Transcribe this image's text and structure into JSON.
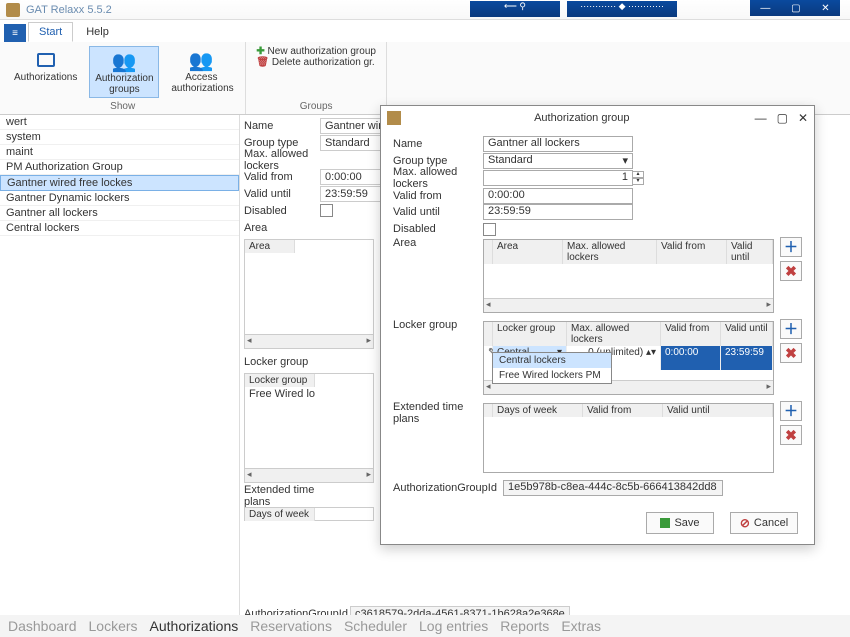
{
  "app": {
    "title": "GAT Relaxx 5.5.2",
    "tabs": {
      "start": "Start",
      "help": "Help"
    }
  },
  "ribbon": {
    "auth": "Authorizations",
    "auth_groups": "Authorization groups",
    "access_auth": "Access authorizations",
    "show": "Show",
    "new_group": "New authorization group",
    "delete_group": "Delete authorization gr.",
    "groups": "Groups"
  },
  "sidebar": {
    "items": [
      "wert",
      "system",
      "maint",
      "PM Authorization Group",
      "Gantner wired free lockes",
      "Gantner Dynamic lockers",
      "Gantner all lockers",
      "Central lockers"
    ]
  },
  "detail": {
    "labels": {
      "name": "Name",
      "group_type": "Group type",
      "max_lockers": "Max. allowed lockers",
      "valid_from": "Valid from",
      "valid_until": "Valid until",
      "disabled": "Disabled",
      "area": "Area",
      "locker_group": "Locker group",
      "ext_plans": "Extended time plans",
      "auth_gid": "AuthorizationGroupId"
    },
    "name": "Gantner wired fr",
    "group_type": "Standard",
    "valid_from": "0:00:00",
    "valid_until": "23:59:59",
    "area_col": "Area",
    "locker_group_col": "Locker group",
    "locker_group_row": "Free Wired lo",
    "days_of_week_col": "Days of week",
    "auth_gid_value": "c3618579-2dda-4561-8371-1b628a2e368e"
  },
  "dialog": {
    "title": "Authorization group",
    "name": "Gantner all lockers",
    "group_type": "Standard",
    "max_lockers": "1",
    "valid_from": "0:00:00",
    "valid_until": "23:59:59",
    "area_cols": {
      "area": "Area",
      "max": "Max. allowed lockers",
      "vf": "Valid from",
      "vu": "Valid until"
    },
    "lg_cols": {
      "lg": "Locker group",
      "max": "Max. allowed lockers",
      "vf": "Valid from",
      "vu": "Valid until"
    },
    "lg_row": {
      "lg": "Central lockers",
      "max": "0 (unlimited)",
      "vf": "0:00:00",
      "vu": "23:59:59"
    },
    "lg_options": [
      "Central lockers",
      "Free Wired lockers PM"
    ],
    "etp_cols": {
      "days": "Days of week",
      "vf": "Valid from",
      "vu": "Valid until"
    },
    "auth_gid_value": "1e5b978b-c8ea-444c-8c5b-666413842dd8",
    "save": "Save",
    "cancel": "Cancel"
  },
  "nav": {
    "items": [
      "Dashboard",
      "Lockers",
      "Authorizations",
      "Reservations",
      "Scheduler",
      "Log entries",
      "Reports",
      "Extras"
    ],
    "active": "Authorizations"
  },
  "win_controls": {
    "min": "—",
    "max": "▢",
    "close": "✕"
  }
}
